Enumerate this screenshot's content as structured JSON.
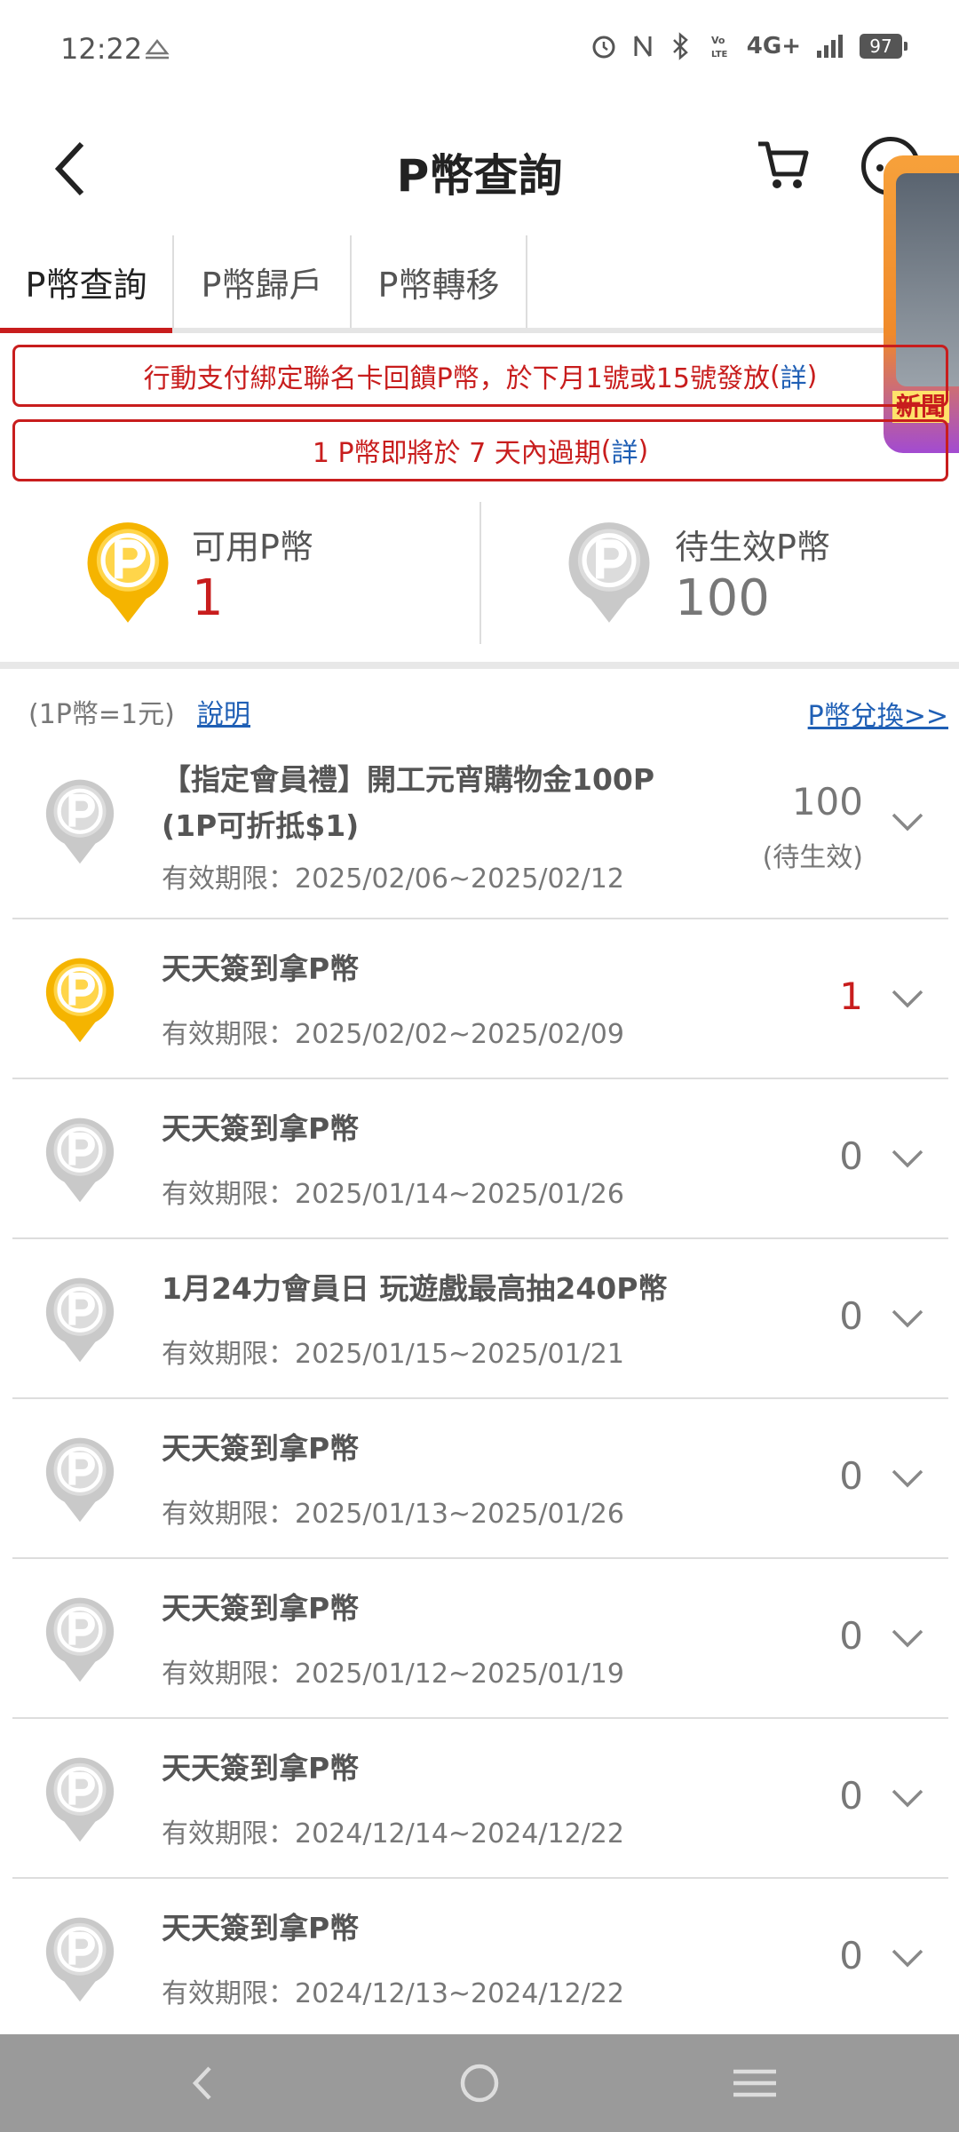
{
  "status_bar": {
    "time": "12:22",
    "network": "4G+",
    "battery": "97"
  },
  "header": {
    "title": "P幣查詢"
  },
  "tabs": [
    {
      "label": "P幣查詢",
      "active": true
    },
    {
      "label": "P幣歸戶",
      "active": false
    },
    {
      "label": "P幣轉移",
      "active": false
    }
  ],
  "notices": [
    {
      "text": "行動支付綁定聯名卡回饋P幣，於下月1號或15號發放",
      "open": "(",
      "link": "詳",
      "close": ")"
    },
    {
      "text": "1 P幣即將於 7 天內過期",
      "open": "(",
      "link": "詳",
      "close": ")"
    }
  ],
  "balance": {
    "available_label": "可用P幣",
    "available_value": "1",
    "pending_label": "待生效P幣",
    "pending_value": "100"
  },
  "info": {
    "rate": "(1P幣=1元)",
    "explain": "說明",
    "exchange": "P幣兌換>>"
  },
  "ad": {
    "label": "新聞"
  },
  "items": [
    {
      "title_line1": "【指定會員禮】開工元宵購物金100P",
      "title_line2": "(1P可折抵$1)",
      "validity": "有效期限：2025/02/06~2025/02/12",
      "amount": "100",
      "status": "(待生效)",
      "active": false
    },
    {
      "title_line1": "天天簽到拿P幣",
      "validity": "有效期限：2025/02/02~2025/02/09",
      "amount": "1",
      "active": true
    },
    {
      "title_line1": "天天簽到拿P幣",
      "validity": "有效期限：2025/01/14~2025/01/26",
      "amount": "0",
      "active": false
    },
    {
      "title_line1": "1月24力會員日 玩遊戲最高抽240P幣",
      "validity": "有效期限：2025/01/15~2025/01/21",
      "amount": "0",
      "active": false
    },
    {
      "title_line1": "天天簽到拿P幣",
      "validity": "有效期限：2025/01/13~2025/01/26",
      "amount": "0",
      "active": false
    },
    {
      "title_line1": "天天簽到拿P幣",
      "validity": "有效期限：2025/01/12~2025/01/19",
      "amount": "0",
      "active": false
    },
    {
      "title_line1": "天天簽到拿P幣",
      "validity": "有效期限：2024/12/14~2024/12/22",
      "amount": "0",
      "active": false
    },
    {
      "title_line1": "天天簽到拿P幣",
      "validity": "有效期限：2024/12/13~2024/12/22",
      "amount": "0",
      "active": false
    }
  ],
  "colors": {
    "accent": "#c81d1d",
    "link": "#1f5fb5",
    "coin_gold": "#f5b400",
    "coin_gray": "#c4c4c4"
  }
}
